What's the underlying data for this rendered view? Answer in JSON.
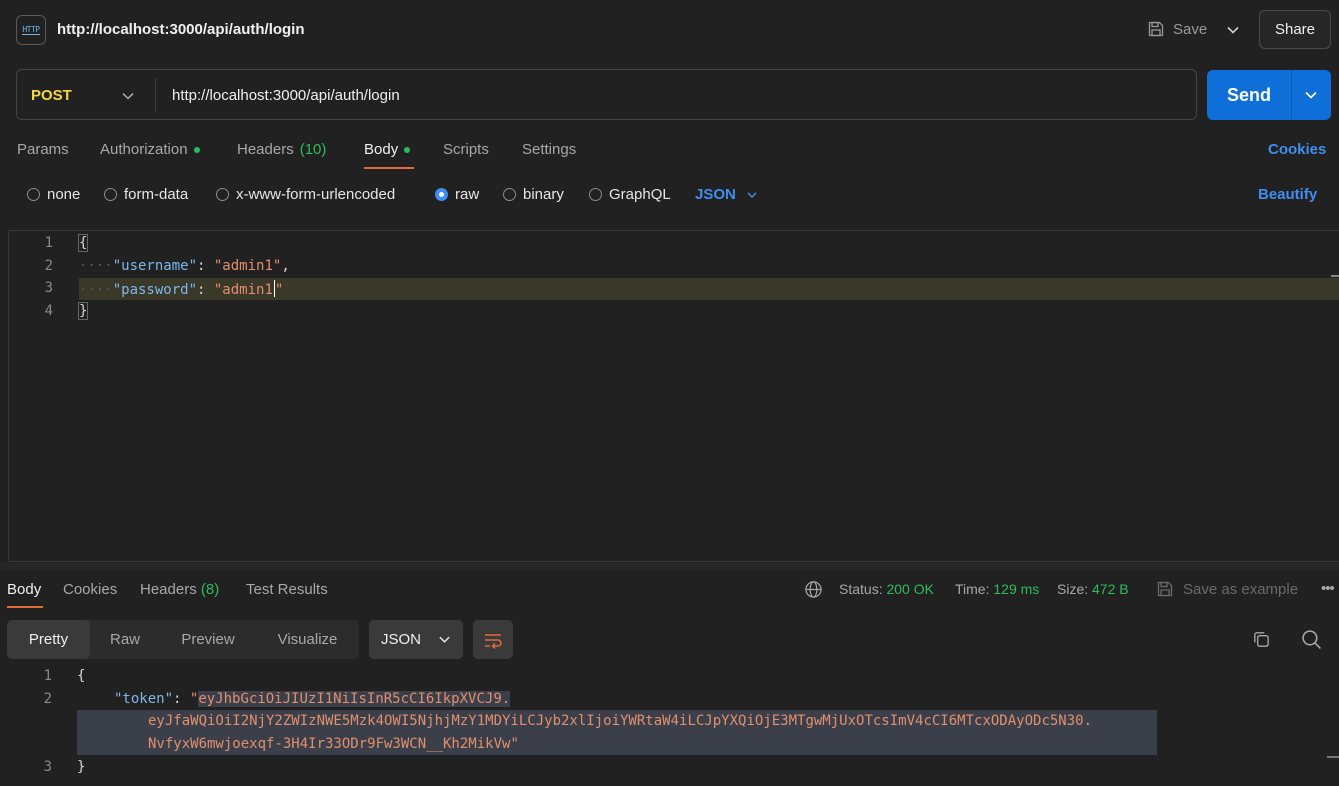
{
  "header": {
    "title": "http://localhost:3000/api/auth/login",
    "icon_text": "HTTP",
    "save_label": "Save",
    "share_label": "Share"
  },
  "request": {
    "method": "POST",
    "url": "http://localhost:3000/api/auth/login",
    "send_label": "Send"
  },
  "tabs": {
    "params": "Params",
    "authorization": "Authorization",
    "headers": "Headers",
    "headers_count": "(10)",
    "body": "Body",
    "scripts": "Scripts",
    "settings": "Settings",
    "cookies": "Cookies"
  },
  "body_types": {
    "none": "none",
    "form_data": "form-data",
    "urlencoded": "x-www-form-urlencoded",
    "raw": "raw",
    "binary": "binary",
    "graphql": "GraphQL",
    "format": "JSON",
    "beautify": "Beautify",
    "selected": "raw"
  },
  "editor": {
    "lines": [
      {
        "num": "1",
        "open": "{"
      },
      {
        "num": "2",
        "key": "\"username\"",
        "value": "\"admin1\"",
        "trail": ","
      },
      {
        "num": "3",
        "key": "\"password\"",
        "value": "\"admin1",
        "value_end": "\""
      },
      {
        "num": "4",
        "close": "}"
      }
    ]
  },
  "response": {
    "tabs": {
      "body": "Body",
      "cookies": "Cookies",
      "headers": "Headers",
      "headers_count": "(8)",
      "test_results": "Test Results"
    },
    "status_label": "Status:",
    "status_value": "200 OK",
    "time_label": "Time:",
    "time_value": "129 ms",
    "size_label": "Size:",
    "size_value": "472 B",
    "save_example": "Save as example",
    "more": "•••",
    "views": {
      "pretty": "Pretty",
      "raw": "Raw",
      "preview": "Preview",
      "visualize": "Visualize"
    },
    "format": "JSON",
    "body_lines": {
      "l1_num": "1",
      "l2_num": "2",
      "l3_num": "3",
      "open": "{",
      "close": "}",
      "key": "\"token\"",
      "token_part1": "eyJhbGciOiJIUzI1NiIsInR5cCI6IkpXVCJ9.",
      "token_part2": "eyJfaWQiOiI2NjY2ZWIzNWE5Mzk4OWI5NjhjMzY1MDYiLCJyb2xlIjoiYWRtaW4iLCJpYXQiOjE3MTgwMjUxOTcsImV4cCI6MTcxODAyODc5N30.",
      "token_part3": "NvfyxW6mwjoexqf-3H4Ir33ODr9Fw3WCN__Kh2MikVw"
    }
  },
  "colors": {
    "accent": "#0f6fd8",
    "method": "#f5d742",
    "success": "#2dbb5a",
    "tab_underline": "#e36a3b",
    "link": "#3f8ef0"
  }
}
